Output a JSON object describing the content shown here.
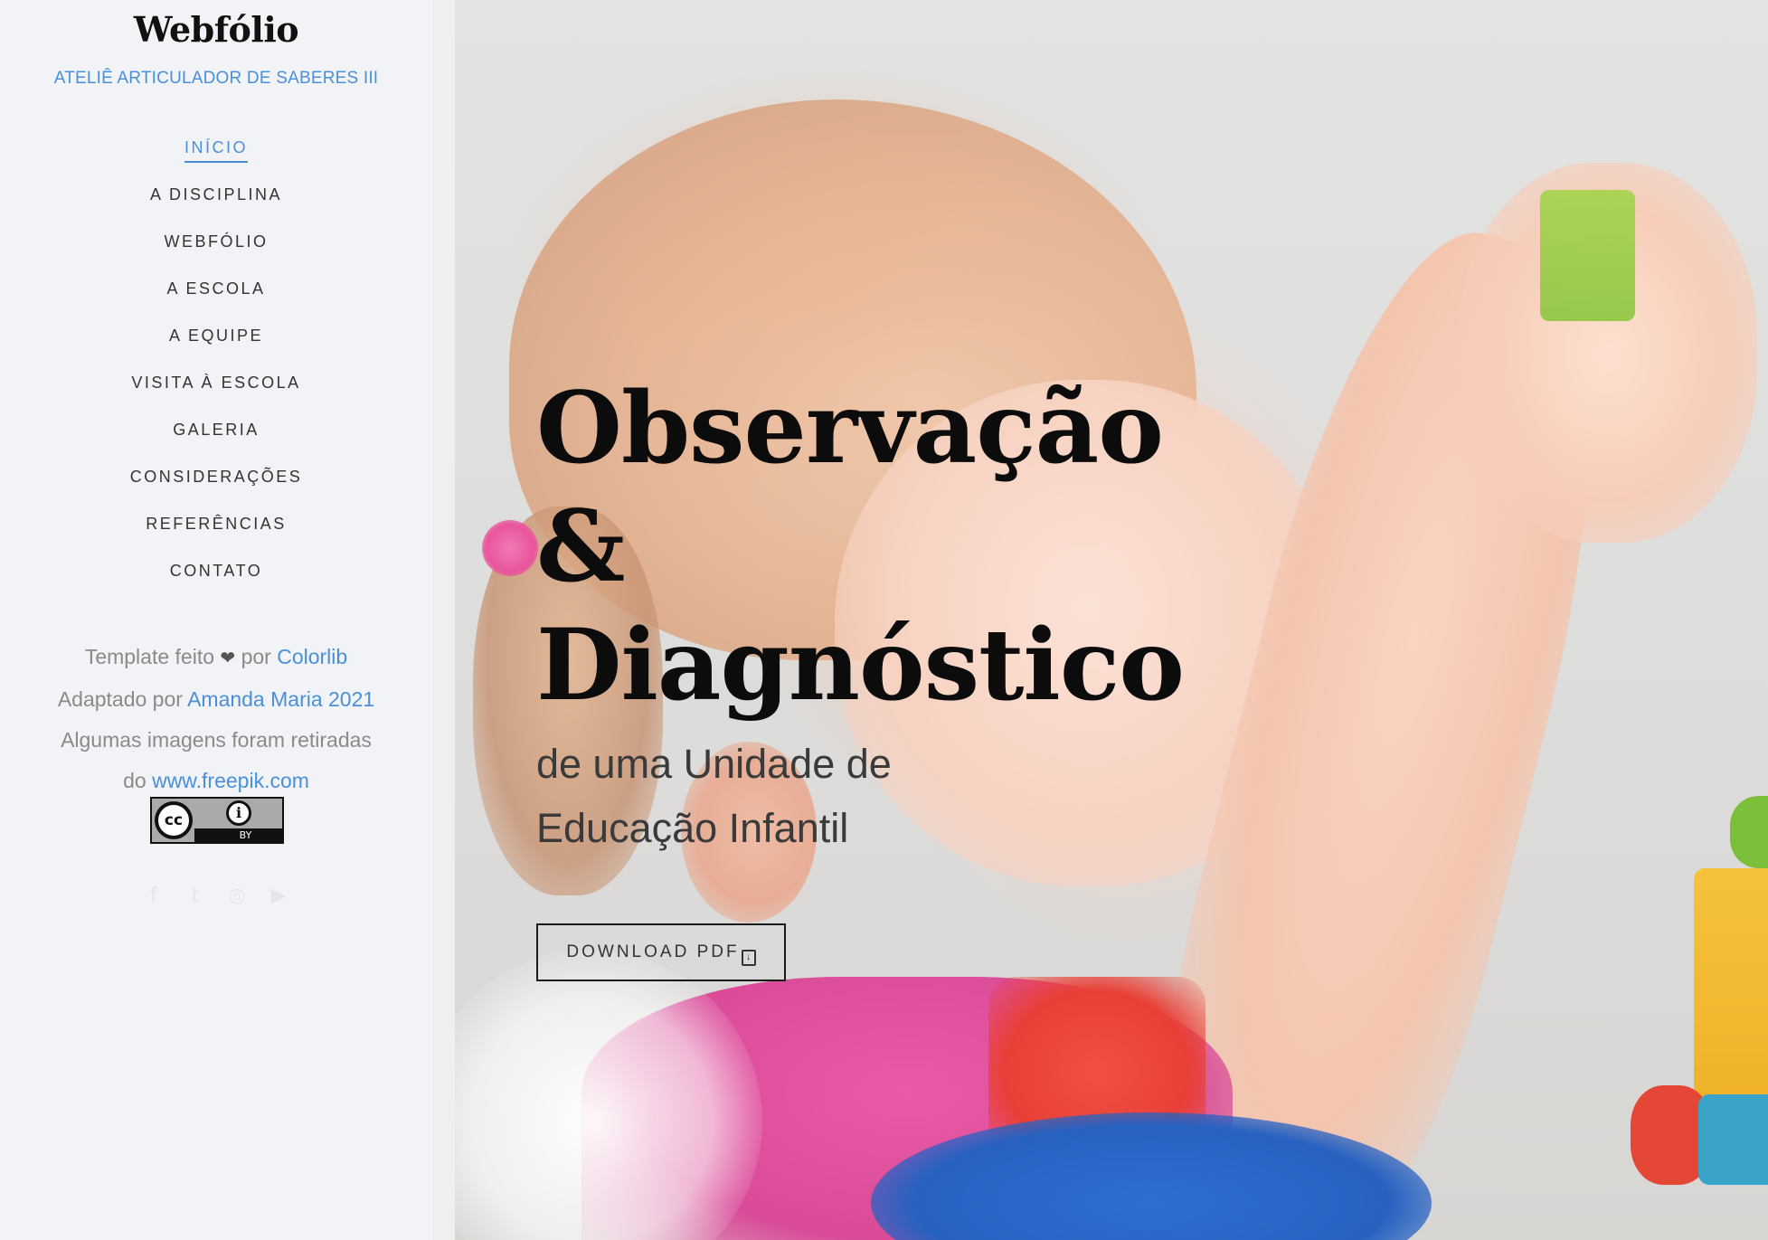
{
  "site": {
    "title": "Webfólio",
    "subtitle": "ATELIÊ ARTICULADOR DE SABERES III"
  },
  "nav": {
    "items": [
      {
        "label": "INÍCIO",
        "active": true
      },
      {
        "label": "A DISCIPLINA"
      },
      {
        "label": "WEBFÓLIO"
      },
      {
        "label": "A ESCOLA"
      },
      {
        "label": "A EQUIPE"
      },
      {
        "label": "VISITA À ESCOLA"
      },
      {
        "label": "GALERIA"
      },
      {
        "label": "CONSIDERAÇÕES"
      },
      {
        "label": "REFERÊNCIAS"
      },
      {
        "label": "CONTATO"
      }
    ]
  },
  "credits": {
    "template_prefix": "Template feito",
    "heart_icon": "heart-icon",
    "template_by": "por",
    "template_link": "Colorlib",
    "adapted_prefix": "Adaptado por",
    "adapted_link": "Amanda Maria 2021",
    "images_text": "Algumas imagens foram retiradas",
    "images_prefix": "do",
    "images_link": "www.freepik.com"
  },
  "license": {
    "cc_label": "cc",
    "by_label": "BY",
    "by_icon": "i"
  },
  "social": {
    "icons": [
      "facebook-icon",
      "twitter-icon",
      "instagram-icon",
      "youtube-icon"
    ]
  },
  "hero": {
    "title_line1": "Observação",
    "title_line2": "&",
    "title_line3": "Diagnóstico",
    "subtitle_line1": "de uma Unidade de",
    "subtitle_line2": "Educação Infantil",
    "download_label": "DOWNLOAD PDF",
    "download_icon": "download-file-icon"
  },
  "colors": {
    "accent": "#4a90d9",
    "sidebar_bg": "#f2f3f7",
    "title_text": "#0c0c0c"
  }
}
